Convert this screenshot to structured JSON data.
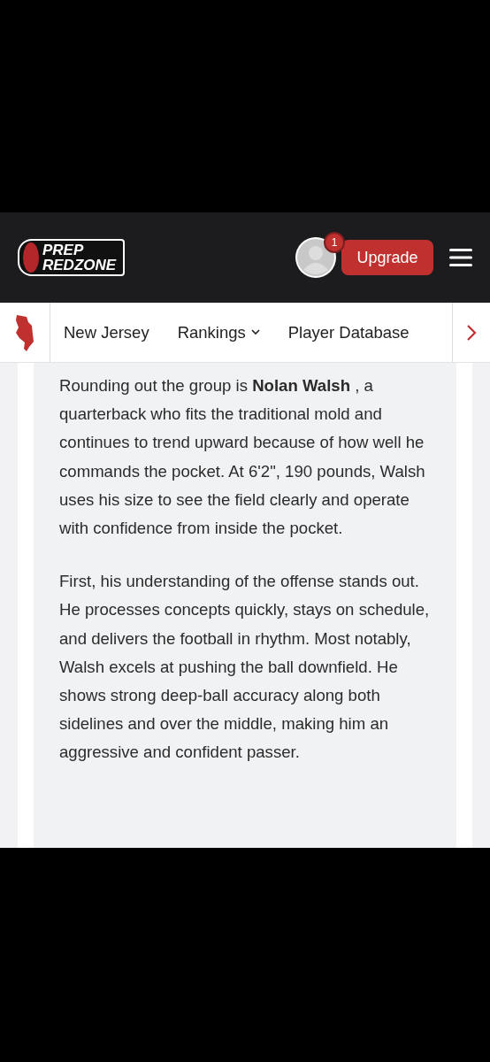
{
  "header": {
    "logo": {
      "line_1": "PREP",
      "line_2": "REDZONE"
    },
    "notifications_badge": "1",
    "upgrade_button": "Upgrade"
  },
  "nav": {
    "items": [
      {
        "label": "New Jersey",
        "kind": "link"
      },
      {
        "label": "Rankings",
        "kind": "dropdown"
      },
      {
        "label": "Player Database",
        "kind": "link"
      }
    ]
  },
  "article": {
    "paragraphs": [
      "Rounding out the group is **Nolan Walsh** , a quarterback who fits the traditional mold and continues to trend upward because of how well he commands the pocket. At 6'2\", 190 pounds, Walsh uses his size to see the field clearly and operate with confidence from inside the pocket.",
      "First, his understanding of the offense stands out. He processes concepts quickly, stays on schedule, and delivers the football in rhythm. Most notably, Walsh excels at pushing the ball downfield. He shows strong deep-ball accuracy along both sidelines and over the middle, making him an aggressive and confident passer."
    ]
  }
}
